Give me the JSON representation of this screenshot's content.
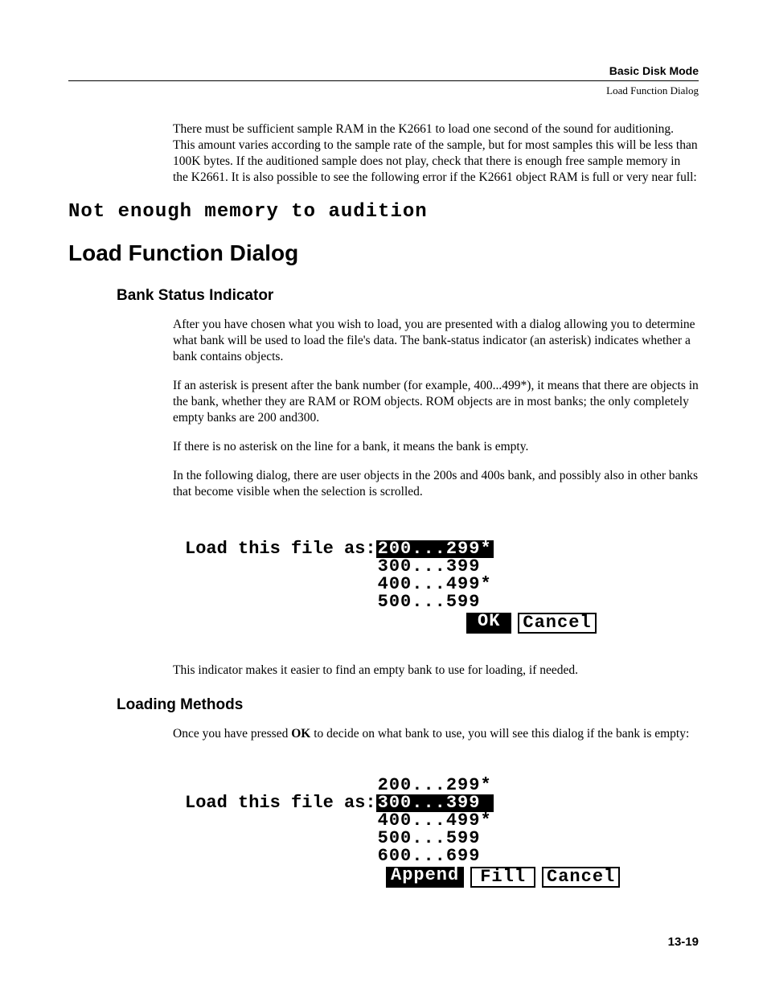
{
  "header": {
    "section": "Basic Disk Mode",
    "subsection": "Load Function Dialog"
  },
  "intro_para": "There must be sufficient sample RAM in the K2661 to load one second of the sound for auditioning. This amount varies according to the sample rate of the sample, but for most samples this will be less than 100K bytes. If the auditioned sample does not play, check that there is enough free sample memory in the K2661. It is also possible to see the following error if the K2661 object RAM is full or very near full:",
  "error_line": "Not enough memory to audition",
  "h1": "Load Function Dialog",
  "h2_bank": "Bank Status Indicator",
  "bank_p1": "After you have chosen what you wish to load, you are presented with a dialog allowing you to determine what bank will be used to load the file's data. The bank-status indicator (an asterisk) indicates whether a bank contains objects.",
  "bank_p2": "If an asterisk is present after the bank number (for example, 400...499*), it means that there are objects in the bank, whether they are RAM or ROM objects. ROM objects are in most banks; the only completely empty banks are 200 and300.",
  "bank_p3": "If there is no asterisk on the line for a bank, it means the bank is empty.",
  "bank_p4": "In the following dialog, there are user objects in the 200s and 400s bank, and possibly also in other banks that become visible when the selection is scrolled.",
  "dialog1": {
    "prompt": "Load this file as:",
    "items": [
      "200...299*",
      "300...399 ",
      "400...499*",
      "500...599 "
    ],
    "selected_index": 0,
    "buttons": {
      "ok": "OK",
      "cancel": "Cancel"
    }
  },
  "bank_p5": "This indicator makes it easier to find an empty bank to use for loading, if needed.",
  "h2_loading": "Loading Methods",
  "loading_p1_pre": "Once you have pressed ",
  "loading_p1_bold": "OK",
  "loading_p1_post": " to decide on what bank to use, you will see this dialog if the bank is empty:",
  "dialog2": {
    "prompt": "Load this file as:",
    "items": [
      "200...299*",
      "300...399 ",
      "400...499*",
      "500...599 ",
      "600...699 "
    ],
    "selected_index": 1,
    "buttons": {
      "append": "Append",
      "fill": "Fill",
      "cancel": "Cancel"
    }
  },
  "page_number": "13-19"
}
